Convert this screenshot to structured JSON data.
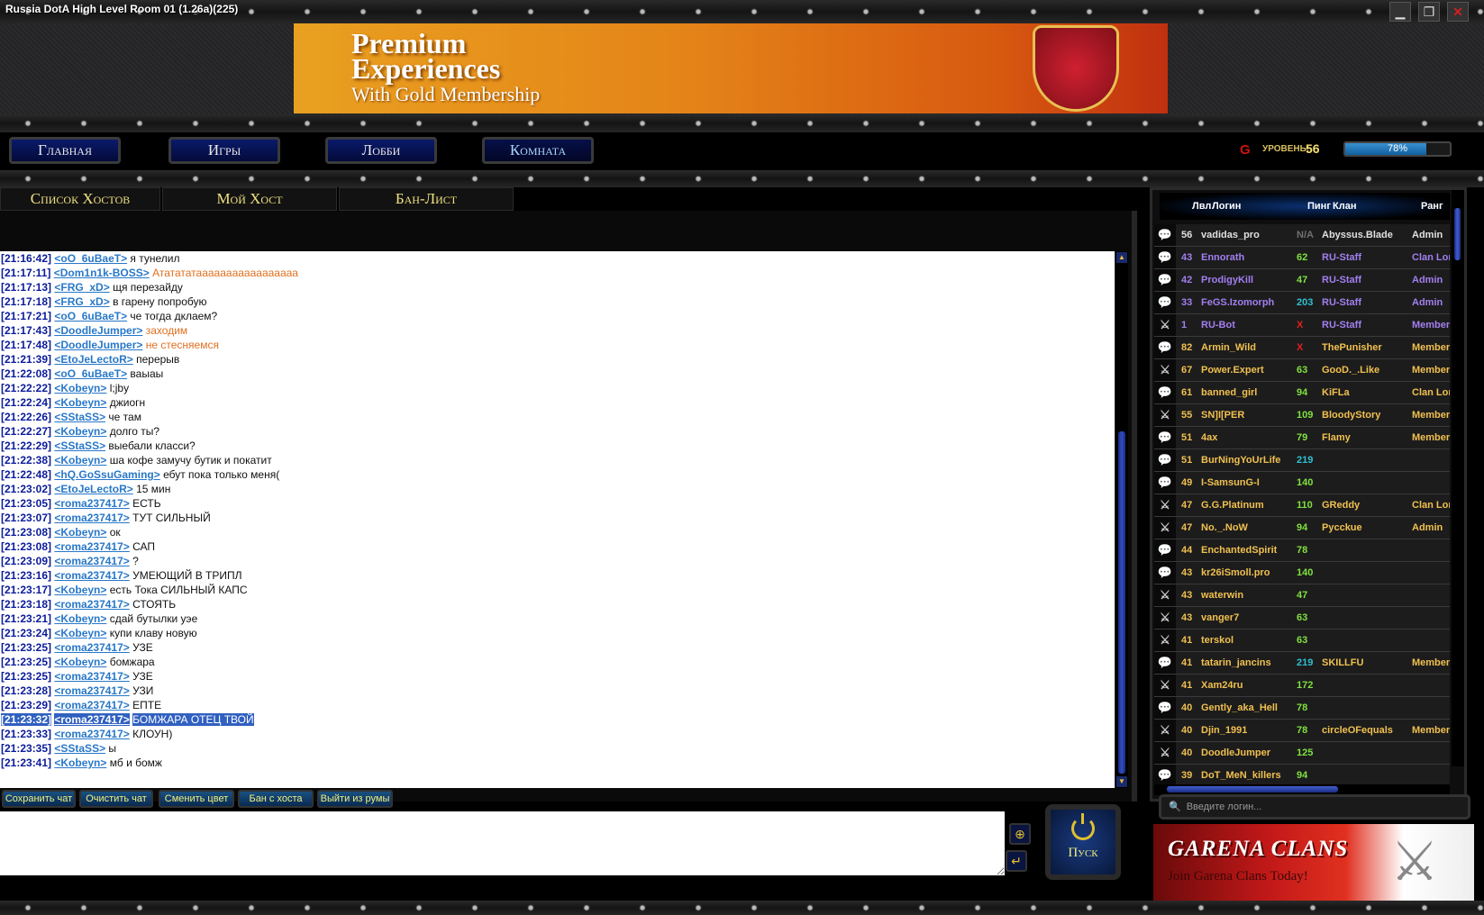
{
  "window": {
    "title": "Russia DotA High Level Room 01 (1.26a)(225)",
    "minimize": "▁",
    "restore": "❐",
    "close": "✕"
  },
  "ad": {
    "line1": "Premium",
    "line2": "Experiences",
    "line3": "With Gold Membership",
    "logo": "G"
  },
  "nav": {
    "items": [
      "Главная",
      "Игры",
      "Лобби",
      "Комната"
    ],
    "active": 3
  },
  "level": {
    "label": "УРОВЕНЬ:",
    "value": "56",
    "progress_percent": 78,
    "progress_text": "78%"
  },
  "subtabs": [
    "Список Хостов",
    "Мой Хост",
    "Бан-Лист"
  ],
  "chat": [
    {
      "t": "[21:16:42]",
      "n": "<oO_6uBaeT>",
      "m": "я тунелил"
    },
    {
      "t": "[21:17:11]",
      "n": "<Dom1n1k-BOSS>",
      "m": "Ататататааааааааааааааааа",
      "c": "orange"
    },
    {
      "t": "[21:17:13]",
      "n": "<FRG_xD>",
      "m": "щя перезайду"
    },
    {
      "t": "[21:17:18]",
      "n": "<FRG_xD>",
      "m": "в гарену попробую"
    },
    {
      "t": "[21:17:21]",
      "n": "<oO_6uBaeT>",
      "m": "че тогда дклаем?"
    },
    {
      "t": "[21:17:43]",
      "n": "<DoodleJumper>",
      "m": "заходим",
      "c": "orange"
    },
    {
      "t": "[21:17:48]",
      "n": "<DoodleJumper>",
      "m": "не стесняемся",
      "c": "orange"
    },
    {
      "t": "[21:21:39]",
      "n": "<EtoJeLectoR>",
      "m": "перерыв"
    },
    {
      "t": "[21:22:08]",
      "n": "<oO_6uBaeT>",
      "m": "ваыаы"
    },
    {
      "t": "[21:22:22]",
      "n": "<Kobeyn>",
      "m": "l;jby"
    },
    {
      "t": "[21:22:24]",
      "n": "<Kobeyn>",
      "m": "джиогн"
    },
    {
      "t": "[21:22:26]",
      "n": "<SStaSS>",
      "m": "че там"
    },
    {
      "t": "[21:22:27]",
      "n": "<Kobeyn>",
      "m": "долго ты?"
    },
    {
      "t": "[21:22:29]",
      "n": "<SStaSS>",
      "m": "выебали класси?"
    },
    {
      "t": "[21:22:38]",
      "n": "<Kobeyn>",
      "m": "ша кофе замучу бутик и покатит"
    },
    {
      "t": "[21:22:48]",
      "n": "<hQ.GoSsuGaming>",
      "m": "ебут пока только меня("
    },
    {
      "t": "[21:23:02]",
      "n": "<EtoJeLectoR>",
      "m": "15 мин"
    },
    {
      "t": "[21:23:05]",
      "n": "<roma237417>",
      "m": "ЕСТЬ"
    },
    {
      "t": "[21:23:07]",
      "n": "<roma237417>",
      "m": "ТУТ СИЛЬНЫЙ"
    },
    {
      "t": "[21:23:08]",
      "n": "<Kobeyn>",
      "m": "ок"
    },
    {
      "t": "[21:23:08]",
      "n": "<roma237417>",
      "m": "САП"
    },
    {
      "t": "[21:23:09]",
      "n": "<roma237417>",
      "m": "?"
    },
    {
      "t": "[21:23:16]",
      "n": "<roma237417>",
      "m": "УМЕЮЩИЙ В ТРИПЛ"
    },
    {
      "t": "[21:23:17]",
      "n": "<Kobeyn>",
      "m": "есть Тока СИЛЬНЫЙ КАПС"
    },
    {
      "t": "[21:23:18]",
      "n": "<roma237417>",
      "m": "СТОЯТЬ"
    },
    {
      "t": "[21:23:21]",
      "n": "<Kobeyn>",
      "m": "сдай бутылки уэе"
    },
    {
      "t": "[21:23:24]",
      "n": "<Kobeyn>",
      "m": "купи клаву новую"
    },
    {
      "t": "[21:23:25]",
      "n": "<roma237417>",
      "m": "УЗЕ"
    },
    {
      "t": "[21:23:25]",
      "n": "<Kobeyn>",
      "m": "бомжара"
    },
    {
      "t": "[21:23:25]",
      "n": "<roma237417>",
      "m": "УЗЕ"
    },
    {
      "t": "[21:23:28]",
      "n": "<roma237417>",
      "m": "УЗИ"
    },
    {
      "t": "[21:23:29]",
      "n": "<roma237417>",
      "m": "ЕПТЕ"
    },
    {
      "t": "[21:23:32]",
      "n": "<roma237417>",
      "m": "БОМЖАРА ОТЕЦ ТВОЙ",
      "selected": true
    },
    {
      "t": "[21:23:33]",
      "n": "<roma237417>",
      "m": "КЛОУН)"
    },
    {
      "t": "[21:23:35]",
      "n": "<SStaSS>",
      "m": "ы"
    },
    {
      "t": "[21:23:41]",
      "n": "<Kobeyn>",
      "m": "мб и бомж"
    }
  ],
  "chat_buttons": [
    "Сохранить чат",
    "Очистить чат",
    "Сменить цвет",
    "Бан с хоста",
    "Выйти из румы"
  ],
  "input": {
    "value": ""
  },
  "start": {
    "label": "Пуск"
  },
  "players": {
    "headers": {
      "lvl": "Лвл",
      "login": "Логин",
      "ping": "Пинг",
      "clan": "Клан",
      "rank": "Ранг"
    },
    "colors": {
      "white": "#e0e0e0",
      "staff": "#a27ff0",
      "normal": "#f0c050",
      "ping_green": "#80e040",
      "ping_cyan": "#30c0d0",
      "ping_red": "#e02020",
      "ping_na": "#707070"
    },
    "rows": [
      {
        "icon": "chat",
        "lvl": "56",
        "name": "vadidas_pro",
        "ping": "N/A",
        "pc": "ping_na",
        "clan": "Abyssus.Blade",
        "rank": "Admin",
        "color": "white"
      },
      {
        "icon": "chat",
        "lvl": "43",
        "name": "Ennorath",
        "ping": "62",
        "pc": "ping_green",
        "clan": "RU-Staff",
        "rank": "Clan Lord",
        "color": "staff"
      },
      {
        "icon": "chat",
        "lvl": "42",
        "name": "ProdigyKill",
        "ping": "47",
        "pc": "ping_green",
        "clan": "RU-Staff",
        "rank": "Admin",
        "color": "staff"
      },
      {
        "icon": "chat",
        "lvl": "33",
        "name": "FeGS.Izomorph",
        "ping": "203",
        "pc": "ping_cyan",
        "clan": "RU-Staff",
        "rank": "Admin",
        "color": "staff"
      },
      {
        "icon": "swords",
        "lvl": "1",
        "name": "RU-Bot",
        "ping": "X",
        "pc": "ping_red",
        "clan": "RU-Staff",
        "rank": "Member",
        "color": "staff"
      },
      {
        "icon": "chat",
        "lvl": "82",
        "name": "Armin_Wild",
        "ping": "X",
        "pc": "ping_red",
        "clan": "ThePunisher",
        "rank": "Member",
        "color": "normal"
      },
      {
        "icon": "swords",
        "lvl": "67",
        "name": "Power.Expert",
        "ping": "63",
        "pc": "ping_green",
        "clan": "GooD._.Like",
        "rank": "Member",
        "color": "normal"
      },
      {
        "icon": "chat",
        "lvl": "61",
        "name": "banned_girl",
        "ping": "94",
        "pc": "ping_green",
        "clan": "KiFLa",
        "rank": "Clan Lord",
        "color": "normal"
      },
      {
        "icon": "swords",
        "lvl": "55",
        "name": "SN]I[PER",
        "ping": "109",
        "pc": "ping_green",
        "clan": "BloodyStory",
        "rank": "Member",
        "color": "normal"
      },
      {
        "icon": "chat",
        "lvl": "51",
        "name": "4ax",
        "ping": "79",
        "pc": "ping_green",
        "clan": "Flamy",
        "rank": "Member",
        "color": "normal"
      },
      {
        "icon": "chat",
        "lvl": "51",
        "name": "BurNingYoUrLife",
        "ping": "219",
        "pc": "ping_cyan",
        "clan": "",
        "rank": "",
        "color": "normal"
      },
      {
        "icon": "chat",
        "lvl": "49",
        "name": "I-SamsunG-I",
        "ping": "140",
        "pc": "ping_green",
        "clan": "",
        "rank": "",
        "color": "normal"
      },
      {
        "icon": "swords",
        "lvl": "47",
        "name": "G.G.Platinum",
        "ping": "110",
        "pc": "ping_green",
        "clan": "GReddy",
        "rank": "Clan Lord",
        "color": "normal"
      },
      {
        "icon": "swords",
        "lvl": "47",
        "name": "No._.NoW",
        "ping": "94",
        "pc": "ping_green",
        "clan": "Pycckue",
        "rank": "Admin",
        "color": "normal"
      },
      {
        "icon": "chat",
        "lvl": "44",
        "name": "EnchantedSpirit",
        "ping": "78",
        "pc": "ping_green",
        "clan": "",
        "rank": "",
        "color": "normal"
      },
      {
        "icon": "chat",
        "lvl": "43",
        "name": "kr26iSmoll.pro",
        "ping": "140",
        "pc": "ping_green",
        "clan": "",
        "rank": "",
        "color": "normal"
      },
      {
        "icon": "swords",
        "lvl": "43",
        "name": "waterwin",
        "ping": "47",
        "pc": "ping_green",
        "clan": "",
        "rank": "",
        "color": "normal"
      },
      {
        "icon": "swords",
        "lvl": "43",
        "name": "vanger7",
        "ping": "63",
        "pc": "ping_green",
        "clan": "",
        "rank": "",
        "color": "normal"
      },
      {
        "icon": "swords",
        "lvl": "41",
        "name": "terskol",
        "ping": "63",
        "pc": "ping_green",
        "clan": "",
        "rank": "",
        "color": "normal"
      },
      {
        "icon": "chat",
        "lvl": "41",
        "name": "tatarin_jancins",
        "ping": "219",
        "pc": "ping_cyan",
        "clan": "SKILLFU",
        "rank": "Member",
        "color": "normal"
      },
      {
        "icon": "swords",
        "lvl": "41",
        "name": "Xam24ru",
        "ping": "172",
        "pc": "ping_green",
        "clan": "",
        "rank": "",
        "color": "normal"
      },
      {
        "icon": "chat",
        "lvl": "40",
        "name": "Gently_aka_Hell",
        "ping": "78",
        "pc": "ping_green",
        "clan": "",
        "rank": "",
        "color": "normal"
      },
      {
        "icon": "swords",
        "lvl": "40",
        "name": "Djin_1991",
        "ping": "78",
        "pc": "ping_green",
        "clan": "circleOFequals",
        "rank": "Member",
        "color": "normal"
      },
      {
        "icon": "swords",
        "lvl": "40",
        "name": "DoodleJumper",
        "ping": "125",
        "pc": "ping_green",
        "clan": "",
        "rank": "",
        "color": "normal"
      },
      {
        "icon": "chat",
        "lvl": "39",
        "name": "DoT_MeN_killers",
        "ping": "94",
        "pc": "ping_green",
        "clan": "",
        "rank": "",
        "color": "normal"
      }
    ]
  },
  "search": {
    "placeholder": "Введите логин..."
  },
  "clans_ad": {
    "title": "GARENA CLANS",
    "subtitle": "Join Garena Clans Today!"
  }
}
